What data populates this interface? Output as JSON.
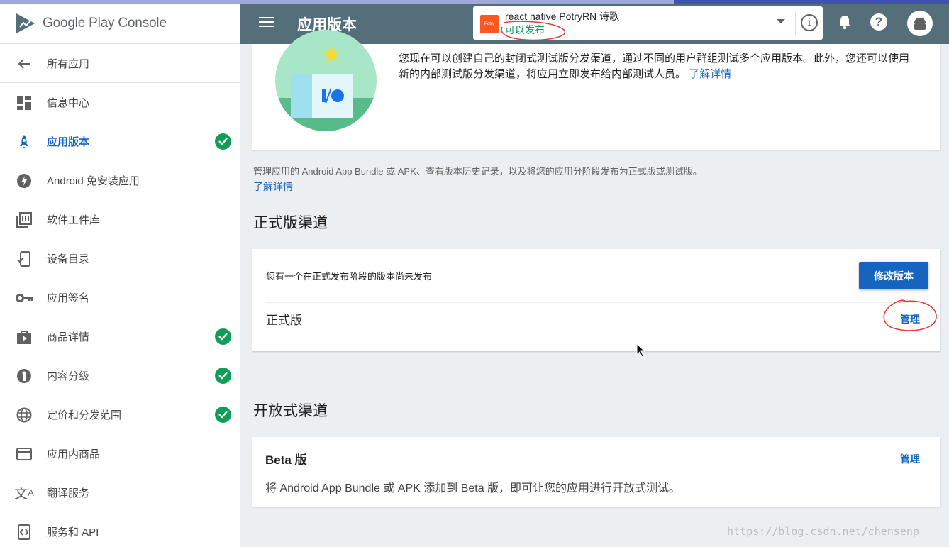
{
  "brand": {
    "name": "Google Play Console"
  },
  "header": {
    "title": "应用版本",
    "app_name": "react native PotryRN 诗歌",
    "app_status": "可以发布",
    "app_icon_text": "Potry",
    "info_icon_glyph": "i",
    "help_icon_glyph": "?"
  },
  "sidebar": {
    "back_label": "所有应用",
    "items": [
      {
        "label": "信息中心",
        "icon": "dashboard-icon",
        "checked": false
      },
      {
        "label": "应用版本",
        "icon": "rocket-icon",
        "checked": true,
        "active": true
      },
      {
        "label": "Android 免安装应用",
        "icon": "bolt-icon",
        "checked": false
      },
      {
        "label": "软件工件库",
        "icon": "library-icon",
        "checked": false
      },
      {
        "label": "设备目录",
        "icon": "device-icon",
        "checked": false
      },
      {
        "label": "应用签名",
        "icon": "key-icon",
        "checked": false
      },
      {
        "label": "商品详情",
        "icon": "store-icon",
        "checked": true
      },
      {
        "label": "内容分级",
        "icon": "rating-icon",
        "checked": true
      },
      {
        "label": "定价和分发范围",
        "icon": "globe-icon",
        "checked": true
      },
      {
        "label": "应用内商品",
        "icon": "card-icon",
        "checked": false
      },
      {
        "label": "翻译服务",
        "icon": "translate-icon",
        "checked": false
      },
      {
        "label": "服务和 API",
        "icon": "api-icon",
        "checked": false
      }
    ]
  },
  "promo": {
    "text": "您现在可以创建自己的封闭式测试版分发渠道，通过不同的用户群组测试多个应用版本。此外，您还可以使用新的内部测试版分发渠道，将应用立即发布给内部测试人员。",
    "link": "了解详情"
  },
  "intro": {
    "text": "管理应用的 Android App Bundle 或 APK、查看版本历史记录，以及将您的应用分阶段发布为正式版或测试版。",
    "link": "了解详情"
  },
  "production": {
    "section_title": "正式版渠道",
    "message": "您有一个在正式发布阶段的版本尚未发布",
    "edit_button": "修改版本",
    "track_name": "正式版",
    "manage_link": "管理"
  },
  "open_track": {
    "section_title": "开放式渠道",
    "beta_title": "Beta 版",
    "beta_desc": "将 Android App Bundle 或 APK 添加到 Beta 版，即可让您的应用进行开放式测试。",
    "manage_link": "管理"
  },
  "watermark": "https://blog.csdn.net/chensenp",
  "colors": {
    "header": "#546e7a",
    "accent": "#1565c0",
    "success": "#0f9d58",
    "annotation": "#e53935"
  }
}
